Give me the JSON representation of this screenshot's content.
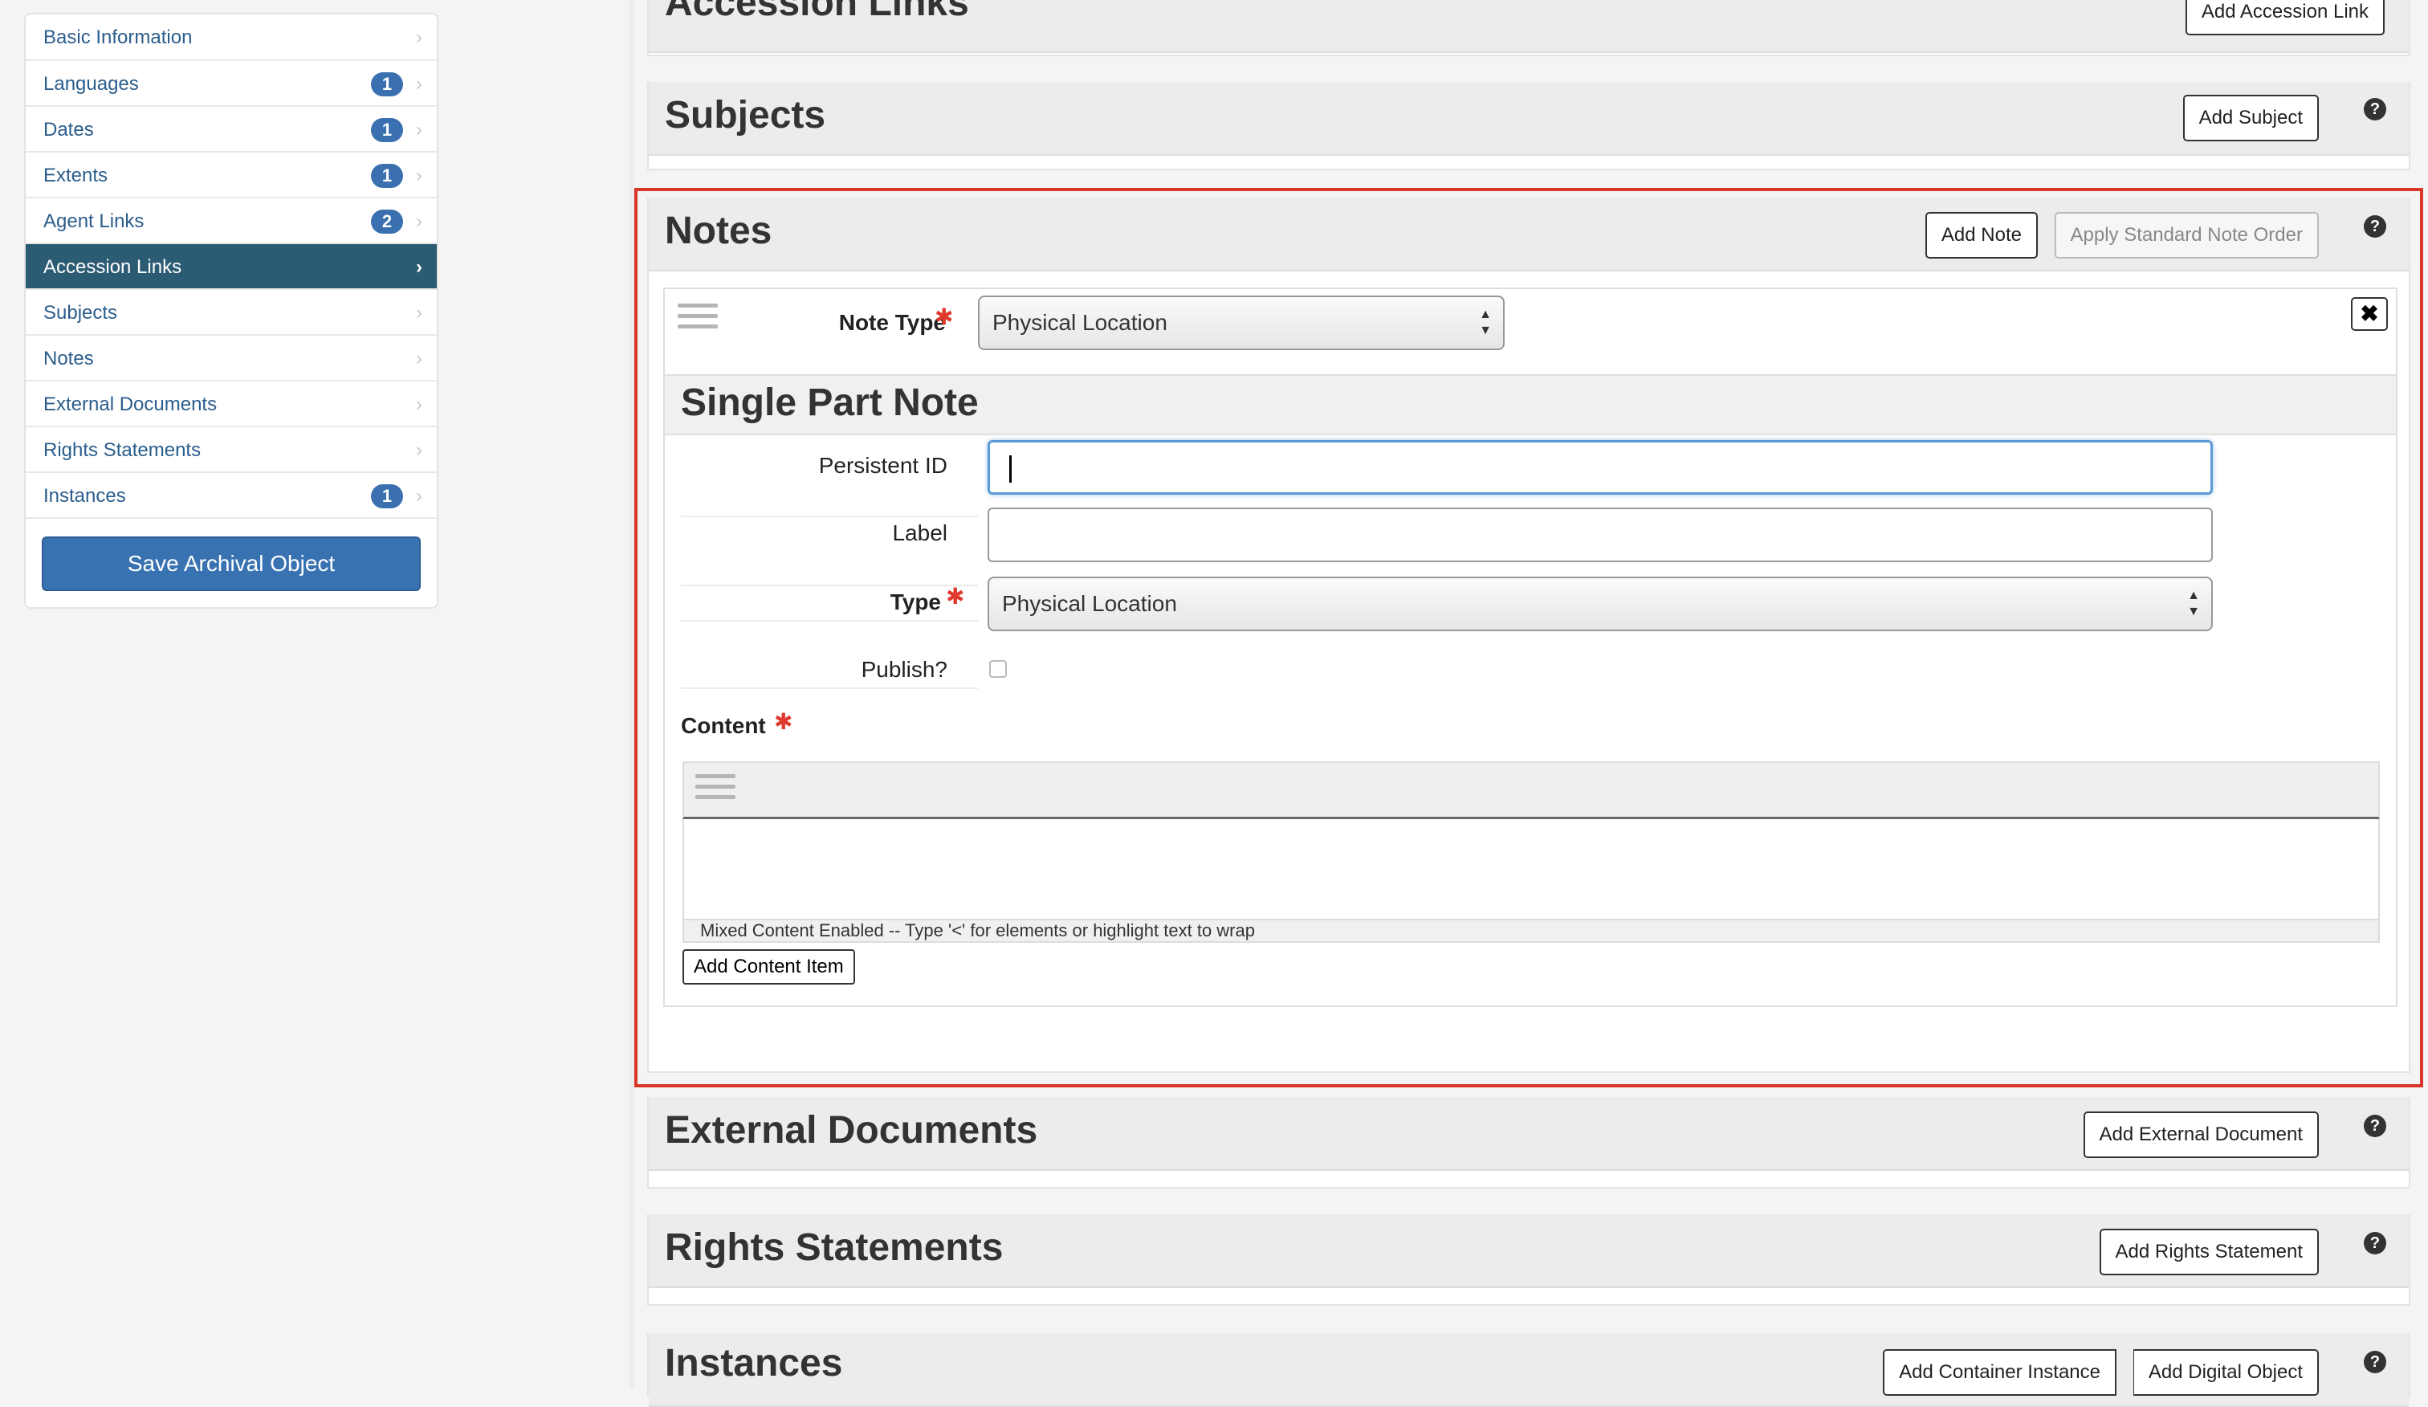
{
  "sidebar": {
    "items": [
      {
        "label": "Basic Information",
        "badge": null
      },
      {
        "label": "Languages",
        "badge": "1"
      },
      {
        "label": "Dates",
        "badge": "1"
      },
      {
        "label": "Extents",
        "badge": "1"
      },
      {
        "label": "Agent Links",
        "badge": "2"
      },
      {
        "label": "Accession Links",
        "badge": null,
        "active": true
      },
      {
        "label": "Subjects",
        "badge": null
      },
      {
        "label": "Notes",
        "badge": null
      },
      {
        "label": "External Documents",
        "badge": null
      },
      {
        "label": "Rights Statements",
        "badge": null
      },
      {
        "label": "Instances",
        "badge": "1"
      }
    ],
    "save_label": "Save Archival Object"
  },
  "sections": {
    "accession_links": {
      "title": "Accession Links",
      "add_label": "Add Accession Link"
    },
    "subjects": {
      "title": "Subjects",
      "add_label": "Add Subject"
    },
    "notes": {
      "title": "Notes",
      "add_label": "Add Note",
      "order_label": "Apply Standard Note Order"
    },
    "external_documents": {
      "title": "External Documents",
      "add_label": "Add External Document"
    },
    "rights_statements": {
      "title": "Rights Statements",
      "add_label": "Add Rights Statement"
    },
    "instances": {
      "title": "Instances",
      "add_container_label": "Add Container Instance",
      "add_digital_label": "Add Digital Object"
    }
  },
  "note_form": {
    "note_type_label": "Note Type",
    "note_type_value": "Physical Location",
    "subheading": "Single Part Note",
    "persistent_id_label": "Persistent ID",
    "persistent_id_value": "",
    "label_label": "Label",
    "label_value": "",
    "type_label": "Type",
    "type_value": "Physical Location",
    "publish_label": "Publish?",
    "publish_checked": false,
    "content_label": "Content",
    "editor_hint": "Mixed Content Enabled  --  Type '<' for elements or highlight text to wrap",
    "add_content_label": "Add Content Item"
  },
  "icons": {
    "help": "question-circle-icon",
    "chevron": "chevron-right-icon",
    "close": "close-icon",
    "drag": "drag-handle-icon",
    "required": "asterisk-icon"
  },
  "colors": {
    "accent": "#3872b1",
    "active_nav": "#2c5c74",
    "highlight": "#d9372a",
    "required": "#e03a2e"
  }
}
